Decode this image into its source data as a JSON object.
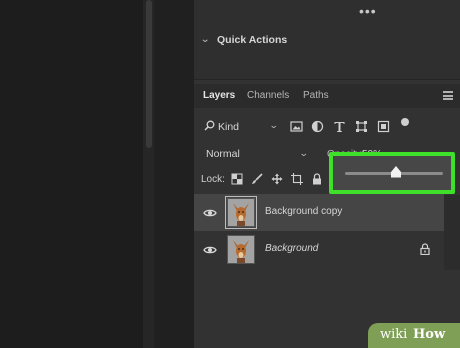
{
  "top_panel": {
    "more_label": "•••"
  },
  "quick_actions": {
    "chevron": "⌄",
    "title": "Quick Actions"
  },
  "tabs": [
    {
      "label": "Layers",
      "active": true
    },
    {
      "label": "Channels",
      "active": false
    },
    {
      "label": "Paths",
      "active": false
    }
  ],
  "filter": {
    "search_glyph": "🔍",
    "kind_label": "Kind",
    "chevron": "⌄",
    "icons": [
      "image-filter-icon",
      "adjustment-filter-icon",
      "type-filter-icon",
      "shape-filter-icon",
      "smart-object-filter-icon"
    ]
  },
  "blend": {
    "mode_label": "Normal",
    "chevron": "⌄"
  },
  "opacity": {
    "label": "Opacity:",
    "value": "50%",
    "slider_value": 0.5
  },
  "lock": {
    "label": "Lock:",
    "icons": [
      "lock-transparent-pixels-icon",
      "lock-image-pixels-icon",
      "lock-position-icon",
      "prevent-autonest-icon",
      "lock-all-icon"
    ]
  },
  "layers": [
    {
      "name": "Background copy",
      "selected": true,
      "italic": false,
      "locked": false
    },
    {
      "name": "Background",
      "selected": false,
      "italic": true,
      "locked": true
    }
  ],
  "highlight_color": "#3ee02a",
  "watermark": {
    "wiki": "wiki",
    "how": "How"
  }
}
